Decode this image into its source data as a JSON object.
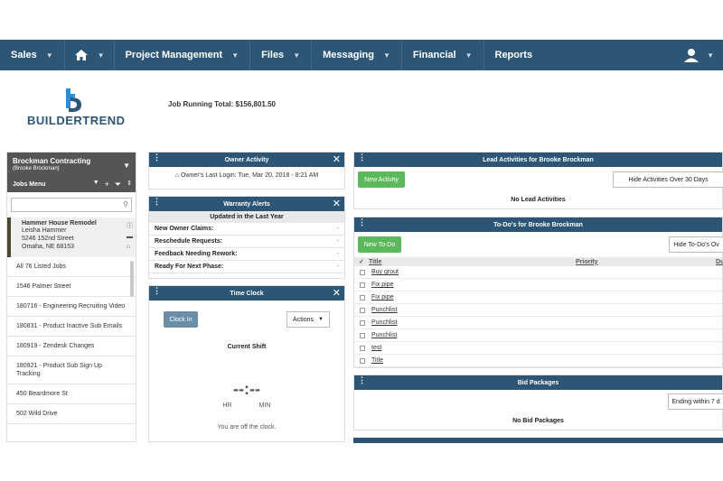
{
  "nav": {
    "items": [
      {
        "label": "Sales"
      },
      {
        "label": "Project Management"
      },
      {
        "label": "Files"
      },
      {
        "label": "Messaging"
      },
      {
        "label": "Financial"
      },
      {
        "label": "Reports"
      }
    ]
  },
  "header": {
    "logo_text": "BUILDERTREND",
    "job_total": "Job Running Total:  $156,801.50"
  },
  "sidebar": {
    "company": "Brockman Contracting",
    "company_sub": "(Brooke Brockman)",
    "jobs_menu": "Jobs Menu",
    "current_job": {
      "title": "Hammer House Remodel",
      "line1": "Leisha Hammer",
      "line2": "5246 152nd Street",
      "line3": "Omaha, NE 68153"
    },
    "jobs": [
      "All 76 Listed Jobs",
      "1546 Palmer Street",
      "180716 - Engineering Recruiting Video",
      "180831 - Product Inactive Sub Emails",
      "180919 - Zendesk Changes",
      "180921 - Product Sub Sign Up Tracking",
      "450 Beardmore St",
      "502 Wild Drive"
    ]
  },
  "owner_activity": {
    "title": "Owner Activity",
    "last_login": "Owner's Last Login: Tue, Mar 20, 2018 - 8:21 AM"
  },
  "warranty": {
    "title": "Warranty Alerts",
    "subtitle": "Updated in the Last Year",
    "rows": [
      {
        "label": "New Owner Claims:",
        "value": "-"
      },
      {
        "label": "Reschedule Requests:",
        "value": "-"
      },
      {
        "label": "Feedback Needing Rework:",
        "value": "-"
      },
      {
        "label": "Ready For Next Phase:",
        "value": "-"
      }
    ]
  },
  "time_clock": {
    "title": "Time Clock",
    "clock_in": "Clock In",
    "actions": "Actions",
    "current_shift": "Current Shift",
    "dashes": "--:--",
    "hr": "HR",
    "min": "MIN",
    "off": "You are off the clock."
  },
  "lead_activities": {
    "title": "Lead Activities for Brooke Brockman",
    "new_button": "New Activity",
    "filter": "Hide Activities Over 30 Days",
    "empty": "No Lead Activities"
  },
  "todos": {
    "title": "To-Do's for Brooke Brockman",
    "new_button": "New To-Do",
    "filter": "Hide To-Do's Ov",
    "col_title": "Title",
    "col_priority": "Priority",
    "col_due": "Du",
    "items": [
      "Buy grout",
      "Fix pipe",
      "Fix pipe",
      "Punchlist",
      "Punchlist",
      "Punchlist",
      "test",
      "Title"
    ]
  },
  "bid_packages": {
    "title": "Bid Packages",
    "filter": "Ending within 7 d",
    "empty": "No Bid Packages"
  },
  "colors": {
    "nav_bg": "#2c5576",
    "accent_green": "#5bb85b"
  }
}
